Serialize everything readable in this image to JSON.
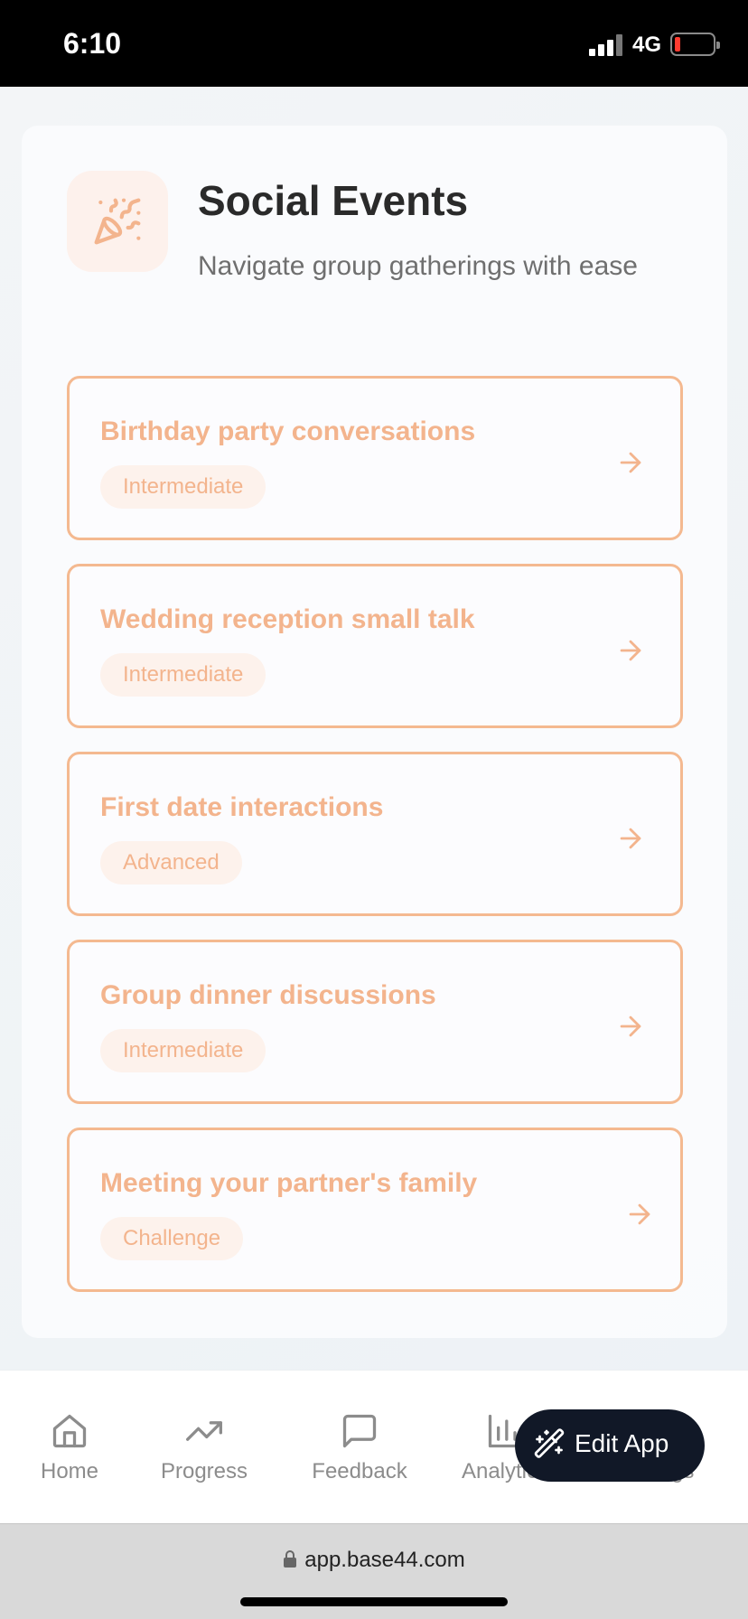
{
  "status_bar": {
    "time": "6:10",
    "network": "4G",
    "battery_color": "#ff3b30"
  },
  "header": {
    "title": "Social Events",
    "subtitle": "Navigate group gatherings with ease",
    "icon": "party-popper-icon"
  },
  "topics": [
    {
      "title": "Birthday party conversations",
      "level": "Intermediate"
    },
    {
      "title": "Wedding reception small talk",
      "level": "Intermediate"
    },
    {
      "title": "First date interactions",
      "level": "Advanced"
    },
    {
      "title": "Group dinner discussions",
      "level": "Intermediate"
    },
    {
      "title": "Meeting your partner's family",
      "level": "Challenge"
    }
  ],
  "tabbar": {
    "items": [
      {
        "label": "Home",
        "icon": "home-icon"
      },
      {
        "label": "Progress",
        "icon": "trending-up-icon"
      },
      {
        "label": "Feedback",
        "icon": "message-square-icon"
      },
      {
        "label": "Analytics",
        "icon": "chart-icon"
      },
      {
        "label": "Settings",
        "icon": "settings-icon"
      }
    ]
  },
  "edit_app": {
    "label": "Edit App",
    "icon": "magic-wand-icon"
  },
  "browser": {
    "url": "app.base44.com"
  },
  "colors": {
    "accent": "#f3b48d",
    "accent_border": "#f4b990",
    "badge_bg": "#fdf2ec",
    "fab_bg": "#111827"
  }
}
